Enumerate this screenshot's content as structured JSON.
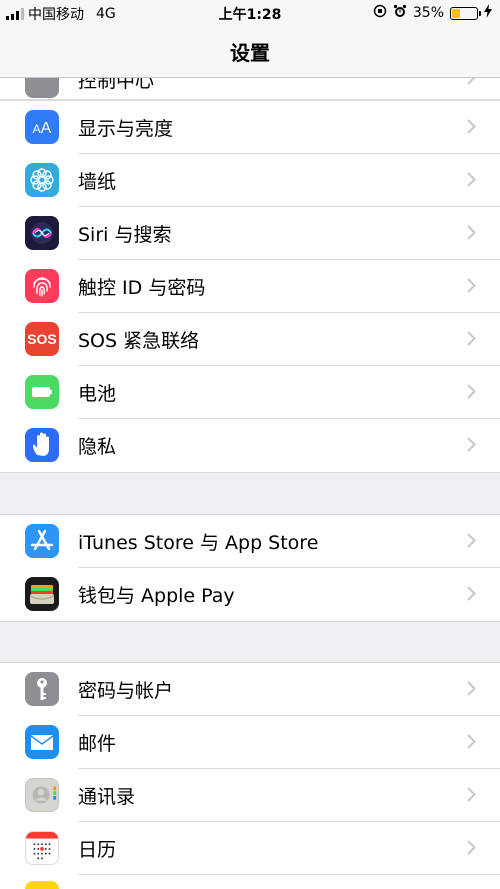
{
  "status_bar": {
    "carrier": "中国移动",
    "network": "4G",
    "time": "上午1:28",
    "battery": "35%",
    "battery_level": 0.35
  },
  "nav": {
    "title": "设置"
  },
  "partial_row": {
    "label": "控制中心"
  },
  "groups": [
    {
      "items": [
        {
          "label": "显示与亮度",
          "icon": "display-brightness-icon",
          "color": "#2f7cf6"
        },
        {
          "label": "墙纸",
          "icon": "wallpaper-icon",
          "color": "#34aadc"
        },
        {
          "label": "Siri 与搜索",
          "icon": "siri-icon",
          "color": "#1c1c3a"
        },
        {
          "label": "触控 ID 与密码",
          "icon": "fingerprint-icon",
          "color": "#ff3b5c"
        },
        {
          "label": "SOS 紧急联络",
          "icon": "sos-icon",
          "color": "#e84232",
          "icon_text": "SOS"
        },
        {
          "label": "电池",
          "icon": "battery-icon",
          "color": "#4cd964"
        },
        {
          "label": "隐私",
          "icon": "hand-icon",
          "color": "#2f6cf6"
        }
      ]
    },
    {
      "items": [
        {
          "label": "iTunes Store 与 App Store",
          "icon": "app-store-icon",
          "color": "#2c95f7"
        },
        {
          "label": "钱包与 Apple Pay",
          "icon": "wallet-icon",
          "color": "#1a1a1a"
        }
      ]
    },
    {
      "items": [
        {
          "label": "密码与帐户",
          "icon": "key-icon",
          "color": "#8e8e93"
        },
        {
          "label": "邮件",
          "icon": "mail-icon",
          "color": "#1f8ef1"
        },
        {
          "label": "通讯录",
          "icon": "contacts-icon",
          "color": "#d6d6d0"
        },
        {
          "label": "日历",
          "icon": "calendar-icon",
          "color": "#ffffff"
        }
      ]
    }
  ]
}
